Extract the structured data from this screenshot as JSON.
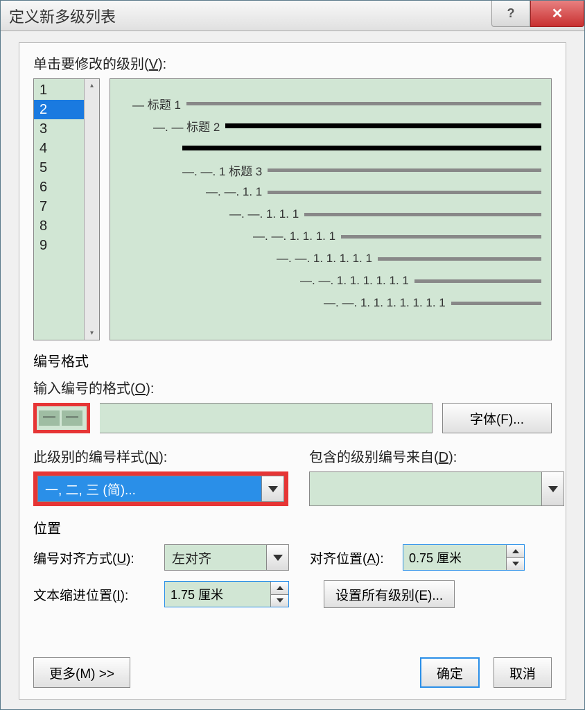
{
  "title": "定义新多级列表",
  "clickLevelLabel": "单击要修改的级别",
  "clickLevelAccel": "V",
  "levels": [
    "1",
    "2",
    "3",
    "4",
    "5",
    "6",
    "7",
    "8",
    "9"
  ],
  "selectedLevel": "2",
  "preview": [
    {
      "indent": 18,
      "text": "— 标题 1",
      "thick": false
    },
    {
      "indent": 48,
      "text": "—. — 标题 2",
      "thick": true
    },
    {
      "indent": 90,
      "text": "",
      "thick": true,
      "baronly": true
    },
    {
      "indent": 90,
      "text": "—. —. 1 标题 3",
      "thick": false
    },
    {
      "indent": 124,
      "text": "—. —. 1. 1",
      "thick": false
    },
    {
      "indent": 158,
      "text": "—. —. 1. 1. 1",
      "thick": false
    },
    {
      "indent": 192,
      "text": "—. —. 1. 1. 1. 1",
      "thick": false
    },
    {
      "indent": 226,
      "text": "—. —. 1. 1. 1. 1. 1",
      "thick": false
    },
    {
      "indent": 260,
      "text": "—. —. 1. 1. 1. 1. 1. 1",
      "thick": false
    },
    {
      "indent": 294,
      "text": "—. —. 1. 1. 1. 1. 1. 1. 1",
      "thick": false
    }
  ],
  "numberFormatSection": "编号格式",
  "enterFormatLabel": "输入编号的格式",
  "enterFormatAccel": "O",
  "formatValue": "—. —",
  "fontButton": "字体(F)...",
  "styleLabel": "此级别的编号样式",
  "styleAccel": "N",
  "styleValue": "一, 二, 三 (简)...",
  "includeLabel": "包含的级别编号来自",
  "includeAccel": "D",
  "includeValue": "",
  "positionSection": "位置",
  "alignLabel": "编号对齐方式",
  "alignAccel": "U",
  "alignValue": "左对齐",
  "alignPosLabel": "对齐位置",
  "alignPosAccel": "A",
  "alignPosValue": "0.75 厘米",
  "indentLabel": "文本缩进位置",
  "indentAccel": "I",
  "indentValue": "1.75 厘米",
  "setAllButton": "设置所有级别(E)...",
  "moreButton": "更多(M) >>",
  "okButton": "确定",
  "cancelButton": "取消"
}
